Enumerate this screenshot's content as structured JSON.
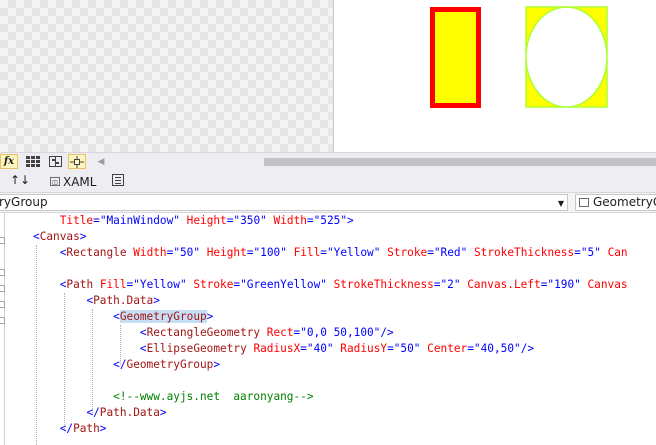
{
  "designer": {
    "rectangle": {
      "fill": "#ffff00",
      "stroke": "#ff0000"
    },
    "path": {
      "fill": "#ffff00",
      "stroke": "#adff2f"
    }
  },
  "toolbar": {
    "fx_label": "fx",
    "items": [
      "effects-toggle",
      "grid-toggle",
      "snap-to-grid",
      "snap-to-snaplines",
      "scroll-left"
    ]
  },
  "tabs": {
    "swap_label": "↑↓",
    "xaml_label": "XAML"
  },
  "navbar": {
    "left_value": "ryGroup",
    "right_value": "GeometryGroup"
  },
  "code": {
    "l1": {
      "indent": "    ",
      "a1": "Title",
      "v1": "\"MainWindow\"",
      "a2": "Height",
      "v2": "\"350\"",
      "a3": "Width",
      "v3": "\"525\"",
      "close": ">"
    },
    "l2": {
      "indent": "",
      "open": "<",
      "tag": "Canvas",
      "close": ">"
    },
    "l3": {
      "indent": "    ",
      "open": "<",
      "tag": "Rectangle",
      "a1": "Width",
      "v1": "\"50\"",
      "a2": "Height",
      "v2": "\"100\"",
      "a3": "Fill",
      "v3": "\"Yellow\"",
      "a4": "Stroke",
      "v4": "\"Red\"",
      "a5": "StrokeThickness",
      "v5": "\"5\"",
      "a6": "Can"
    },
    "l5": {
      "indent": "    ",
      "open": "<",
      "tag": "Path",
      "a1": "Fill",
      "v1": "\"Yellow\"",
      "a2": "Stroke",
      "v2": "\"GreenYellow\"",
      "a3": "StrokeThickness",
      "v3": "\"2\"",
      "a4": "Canvas.Left",
      "v4": "\"190\"",
      "a5": "Canvas"
    },
    "l6": {
      "indent": "        ",
      "open": "<",
      "tag": "Path.Data",
      "close": ">"
    },
    "l7": {
      "indent": "            ",
      "open": "<",
      "tag": "GeometryGroup",
      "close": ">"
    },
    "l8": {
      "indent": "                ",
      "open": "<",
      "tag": "RectangleGeometry",
      "a1": "Rect",
      "v1": "\"0,0 50,100\"",
      "close": "/>"
    },
    "l9": {
      "indent": "                ",
      "open": "<",
      "tag": "EllipseGeometry",
      "a1": "RadiusX",
      "v1": "\"40\"",
      "a2": "RadiusY",
      "v2": "\"50\"",
      "a3": "Center",
      "v3": "\"40,50\"",
      "close": "/>"
    },
    "l10": {
      "indent": "            ",
      "open": "</",
      "tag": "GeometryGroup",
      "close": ">"
    },
    "l12": {
      "indent": "            ",
      "comment": "<!--www.ayjs.net  aaronyang-->"
    },
    "l13": {
      "indent": "        ",
      "open": "</",
      "tag": "Path.Data",
      "close": ">"
    },
    "l14": {
      "indent": "    ",
      "open": "</",
      "tag": "Path",
      "close": ">"
    }
  }
}
